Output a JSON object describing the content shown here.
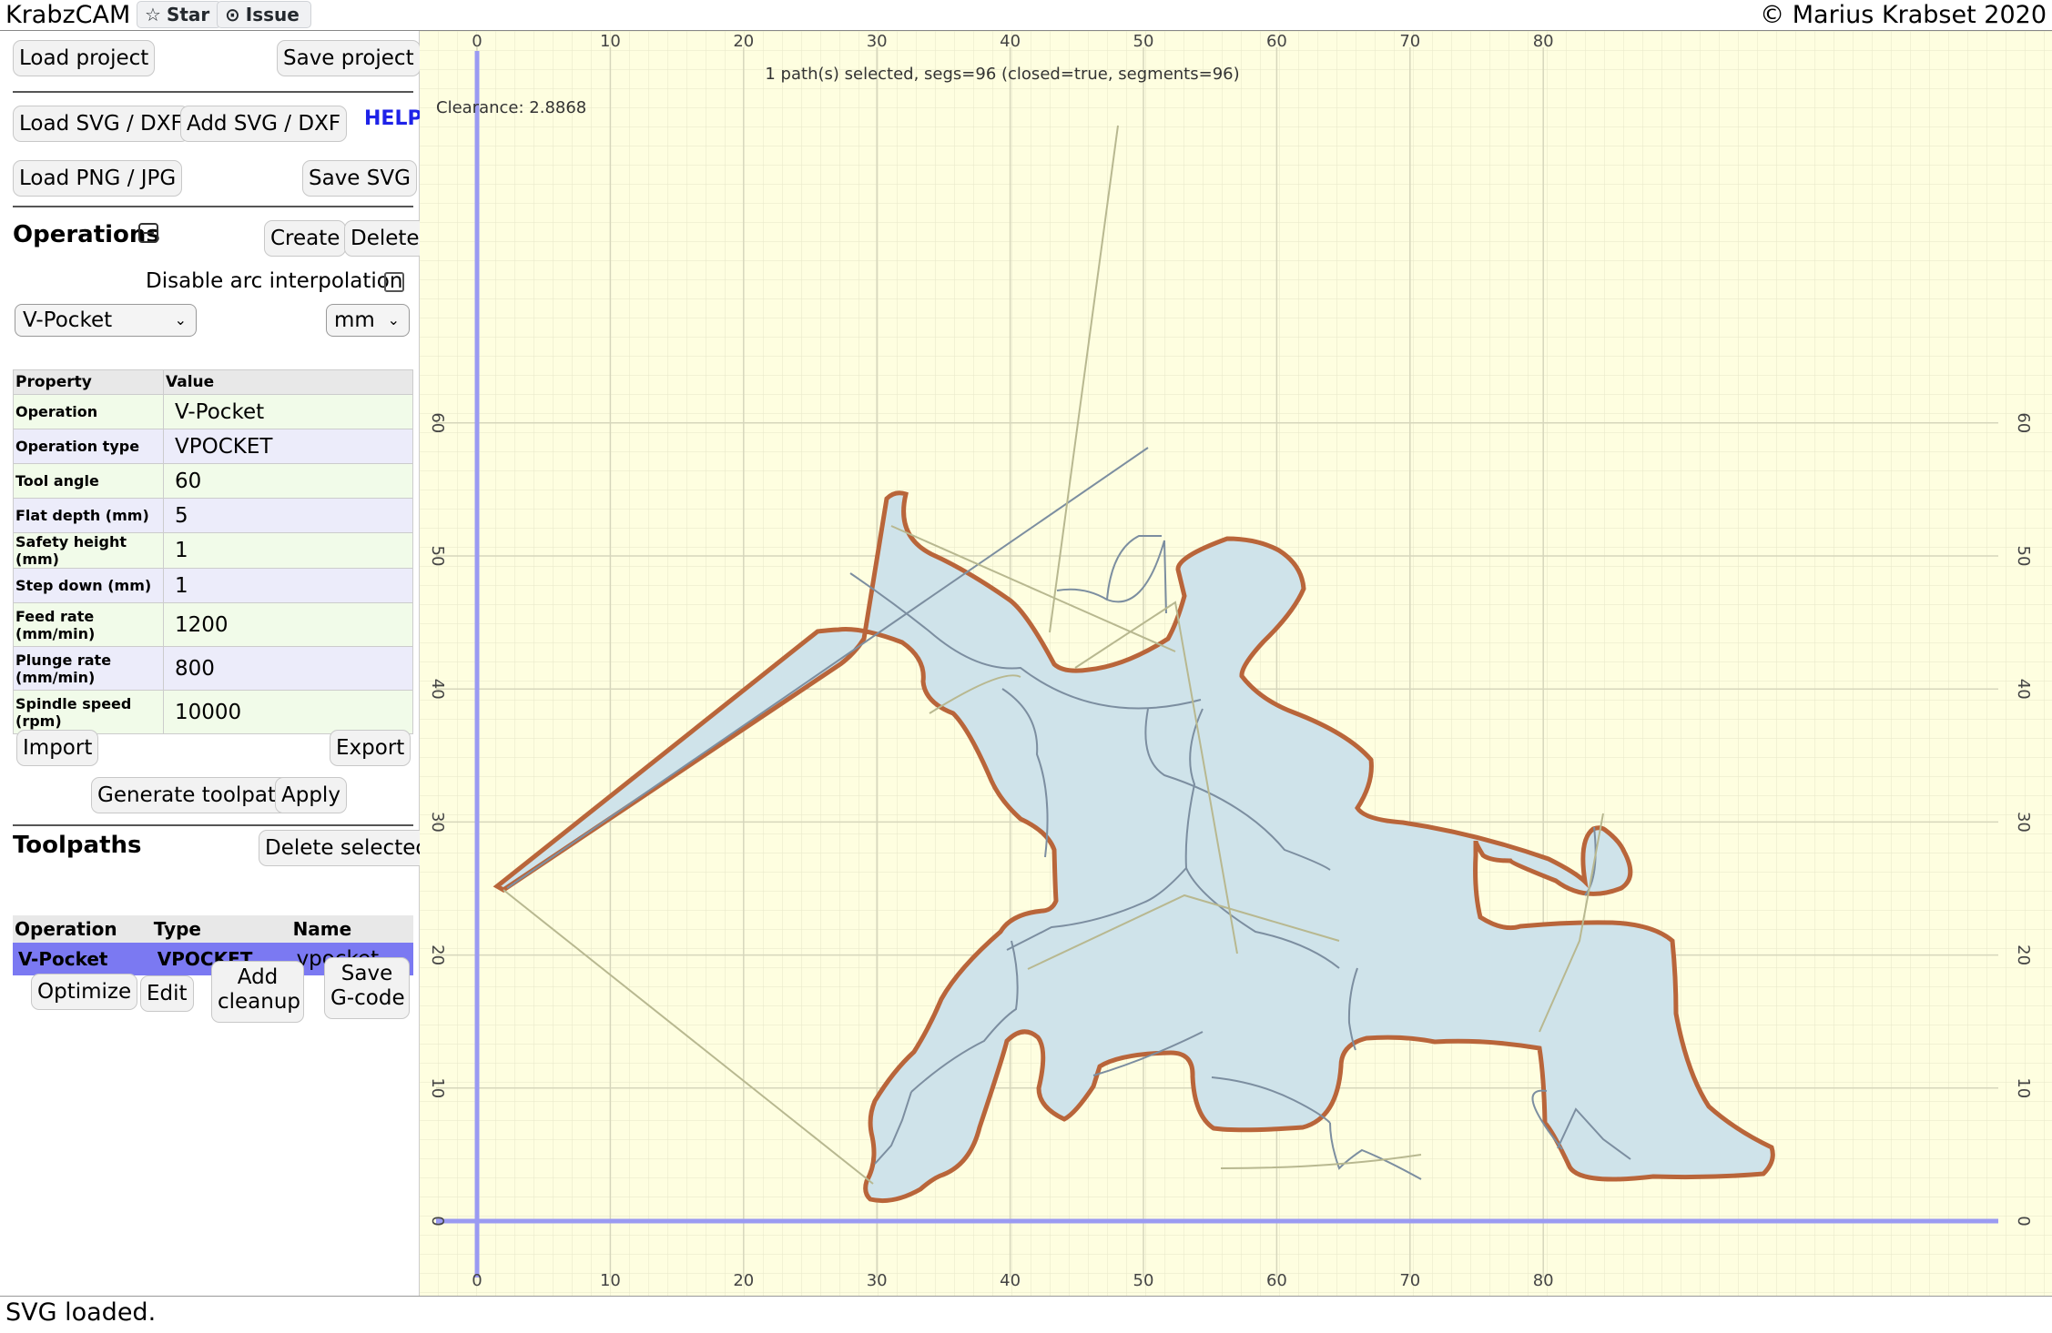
{
  "topbar": {
    "title": "KrabzCAM",
    "star_label": "Star",
    "issue_label": "Issue",
    "copyright": "© Marius Krabset 2020"
  },
  "sidebar": {
    "load_project": "Load project",
    "save_project": "Save project",
    "load_svg": "Load SVG / DXF",
    "add_svg": "Add SVG / DXF",
    "help": "HELP",
    "load_png": "Load PNG / JPG",
    "save_svg": "Save SVG",
    "operations_title": "Operations",
    "create": "Create",
    "delete": "Delete",
    "disable_arc": "Disable arc interpolation",
    "operation_select": "V-Pocket",
    "unit_select": "mm",
    "props_header": {
      "property": "Property",
      "value": "Value"
    },
    "props": [
      {
        "k": "Operation",
        "v": "V-Pocket"
      },
      {
        "k": "Operation type",
        "v": "VPOCKET"
      },
      {
        "k": "Tool angle",
        "v": "60"
      },
      {
        "k": "Flat depth (mm)",
        "v": "5"
      },
      {
        "k": "Safety height (mm)",
        "v": "1"
      },
      {
        "k": "Step down (mm)",
        "v": "1"
      },
      {
        "k": "Feed rate (mm/min)",
        "v": "1200"
      },
      {
        "k": "Plunge rate (mm/min)",
        "v": "800"
      },
      {
        "k": "Spindle speed (rpm)",
        "v": "10000"
      }
    ],
    "import": "Import",
    "export": "Export",
    "generate": "Generate toolpath",
    "apply": "Apply",
    "toolpaths_title": "Toolpaths",
    "delete_selected": "Delete selected",
    "tp_header": {
      "operation": "Operation",
      "type": "Type",
      "name": "Name"
    },
    "tp_row": {
      "operation": "V-Pocket",
      "type": "VPOCKET",
      "name": "vpocket"
    },
    "optimize": "Optimize",
    "edit": "Edit",
    "add_cleanup_1": "Add",
    "add_cleanup_2": "cleanup",
    "save_gcode_1": "Save",
    "save_gcode_2": "G-code"
  },
  "canvas": {
    "selection_info": "1 path(s) selected, segs=96 (closed=true, segments=96)",
    "clearance": "Clearance: 2.8868",
    "x_ticks": [
      "0",
      "10",
      "20",
      "30",
      "40",
      "50",
      "60",
      "70",
      "80"
    ],
    "y_ticks": [
      "0",
      "10",
      "20",
      "30",
      "40",
      "50",
      "60"
    ],
    "colors": {
      "background": "#fefee0",
      "outline": "#b9653a",
      "fill": "#cfe3ea",
      "axis": "#9a9af2"
    }
  },
  "status": {
    "text": "SVG loaded."
  }
}
